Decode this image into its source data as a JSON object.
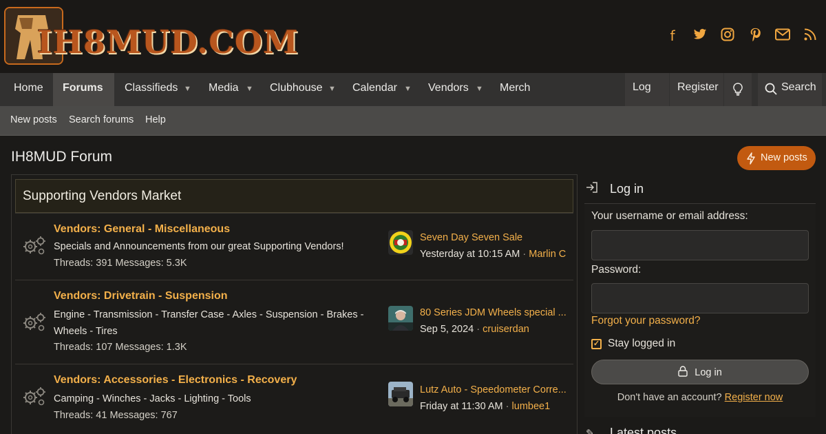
{
  "site": {
    "logo_text": "IH8MUD.COM",
    "accent": "#f3b04a",
    "brand_orange": "#c25a10"
  },
  "social": [
    {
      "icon": "facebook-icon",
      "glyph": "f"
    },
    {
      "icon": "twitter-icon",
      "glyph": "🐦"
    },
    {
      "icon": "instagram-icon",
      "glyph": "◎"
    },
    {
      "icon": "pinterest-icon",
      "glyph": "℗"
    },
    {
      "icon": "email-icon",
      "glyph": "✉"
    },
    {
      "icon": "rss-icon",
      "glyph": "◝"
    }
  ],
  "nav": {
    "home": "Home",
    "forums": "Forums",
    "classifieds": "Classifieds",
    "media": "Media",
    "clubhouse": "Clubhouse",
    "calendar": "Calendar",
    "vendors": "Vendors",
    "merch": "Merch",
    "login": "Log in",
    "register": "Register",
    "search": "Search",
    "caret": "▼"
  },
  "subnav": {
    "new_posts": "New posts",
    "search_forums": "Search forums",
    "help": "Help"
  },
  "page": {
    "title": "IH8MUD Forum",
    "new_posts_button": "New posts"
  },
  "category": {
    "title": "Supporting Vendors Market",
    "nodes": [
      {
        "title": "Vendors: General - Miscellaneous",
        "description": "Specials and Announcements from our great Supporting Vendors!",
        "threads_label": "Threads:",
        "threads": "391",
        "messages_label": "Messages:",
        "messages": "5.3K",
        "latest_title": "Seven Day Seven Sale",
        "latest_date": "Yesterday at 10:15 AM",
        "latest_sep": "·",
        "latest_user": "Marlin C"
      },
      {
        "title": "Vendors: Drivetrain - Suspension",
        "description": "Engine - Transmission - Transfer Case - Axles - Suspension - Brakes - Wheels - Tires",
        "threads_label": "Threads:",
        "threads": "107",
        "messages_label": "Messages:",
        "messages": "1.3K",
        "latest_title": "80 Series JDM Wheels special ...",
        "latest_date": "Sep 5, 2024",
        "latest_sep": "·",
        "latest_user": "cruiserdan"
      },
      {
        "title": "Vendors: Accessories - Electronics - Recovery",
        "description": "Camping - Winches - Jacks - Lighting - Tools",
        "threads_label": "Threads:",
        "threads": "41",
        "messages_label": "Messages:",
        "messages": "767",
        "latest_title": "Lutz Auto - Speedometer Corre...",
        "latest_date": "Friday at 11:30 AM",
        "latest_sep": "·",
        "latest_user": "lumbee1"
      }
    ]
  },
  "sidebar": {
    "login_title": "Log in",
    "username_label": "Your username or email address:",
    "password_label": "Password:",
    "forgot": "Forgot your password?",
    "stay_logged_in": "Stay logged in",
    "login_button": "Log in",
    "no_account": "Don't have an account?",
    "register_now": "Register now",
    "latest_posts_title": "Latest posts"
  }
}
